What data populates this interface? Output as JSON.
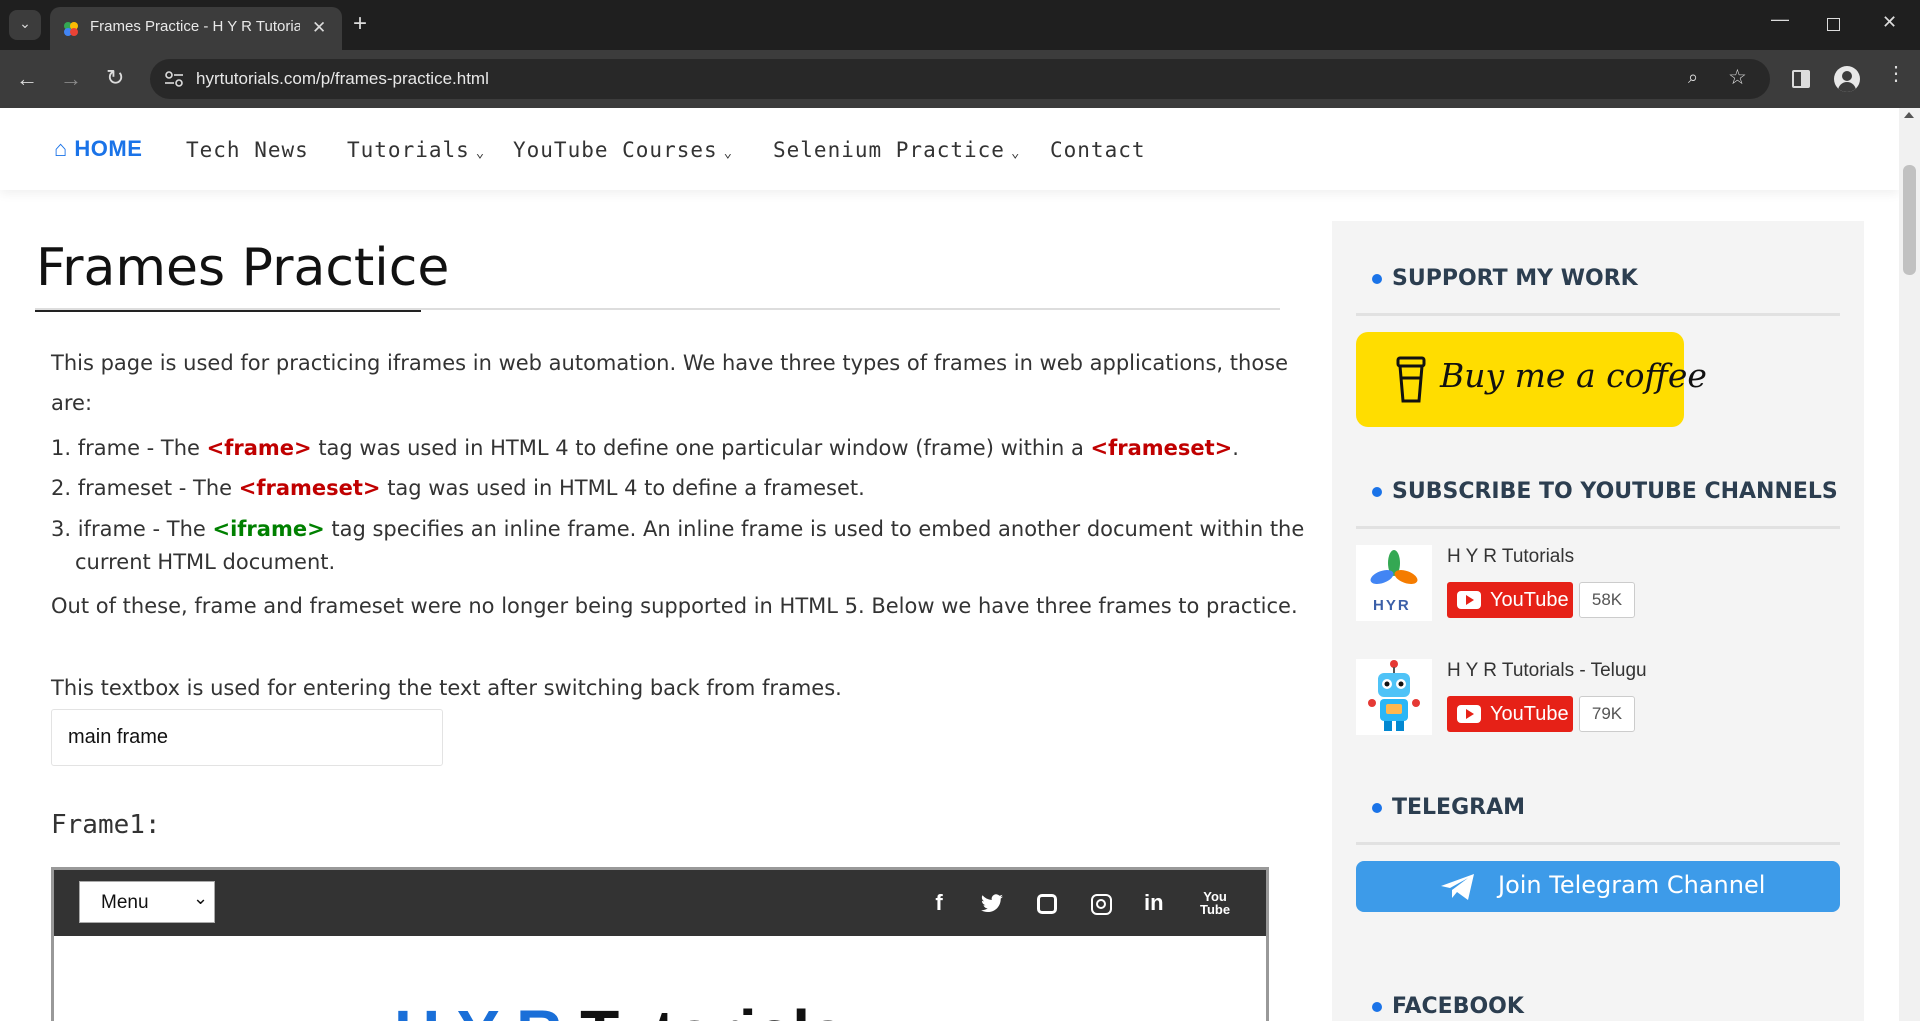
{
  "browser": {
    "tab_title": "Frames Practice - H Y R Tutorials",
    "url": "hyrtutorials.com/p/frames-practice.html"
  },
  "nav": {
    "home": "HOME",
    "items": [
      "Tech News",
      "Tutorials",
      "YouTube Courses",
      "Selenium Practice",
      "Contact"
    ]
  },
  "article": {
    "title": "Frames Practice",
    "intro_line1": "This page is used for practicing iframes in web automation. We have three types of frames in web applications, those",
    "intro_line2": "are:",
    "item1_a": "1. frame - The ",
    "item1_tag": "<frame>",
    "item1_b": " tag was used in HTML 4 to define one particular window (frame) within a ",
    "item1_tag2": "<frameset>",
    "item1_c": ".",
    "item2_a": "2. frameset - The ",
    "item2_tag": "<frameset>",
    "item2_b": " tag was used in HTML 4 to define a frameset.",
    "item3_a": "3. iframe - The ",
    "item3_tag": "<iframe>",
    "item3_b": " tag specifies an inline frame. An inline frame is used to embed another document within the",
    "item3_c": "current HTML document.",
    "outro": "Out of these, frame and frameset were no longer being supported in HTML 5. Below we have three frames to practice.",
    "textbox_label": "This textbox is used for entering the text after switching back from frames.",
    "textbox_value": "main frame",
    "frame1_heading": "Frame1:",
    "frame_menu": "Menu",
    "frame_banner": "H Y R Tutorials"
  },
  "sidebar": {
    "support_heading": "SUPPORT MY WORK",
    "coffee_label": "Buy me a coffee",
    "subscribe_heading": "SUBSCRIBE TO YOUTUBE CHANNELS",
    "channels": [
      {
        "name": "H Y R Tutorials",
        "button": "YouTube",
        "count": "58K",
        "logo": "HYR"
      },
      {
        "name": "H Y R Tutorials - Telugu",
        "button": "YouTube",
        "count": "79K"
      }
    ],
    "telegram_heading": "TELEGRAM",
    "telegram_button": "Join Telegram Channel",
    "facebook_heading": "FACEBOOK"
  }
}
